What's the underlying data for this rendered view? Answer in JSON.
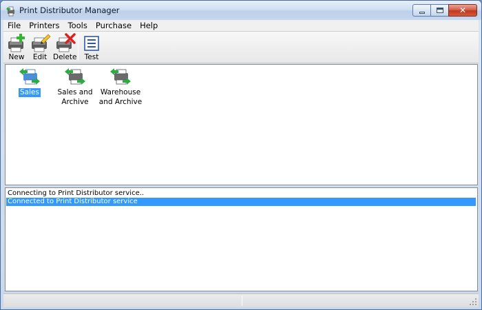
{
  "window": {
    "title": "Print Distributor Manager"
  },
  "menu": {
    "items": [
      "File",
      "Printers",
      "Tools",
      "Purchase",
      "Help"
    ]
  },
  "toolbar": {
    "new_label": "New",
    "edit_label": "Edit",
    "delete_label": "Delete",
    "test_label": "Test"
  },
  "printers": [
    {
      "line1": "Sales",
      "line2": "",
      "selected": true
    },
    {
      "line1": "Sales and",
      "line2": "Archive",
      "selected": false
    },
    {
      "line1": "Warehouse",
      "line2": "and Archive",
      "selected": false
    }
  ],
  "log": [
    {
      "text": "Connecting to Print Distributor service..",
      "selected": false
    },
    {
      "text": "Connected to Print Distributor service",
      "selected": true
    }
  ],
  "colors": {
    "selection": "#3399ff",
    "close_button": "#c0381e"
  }
}
